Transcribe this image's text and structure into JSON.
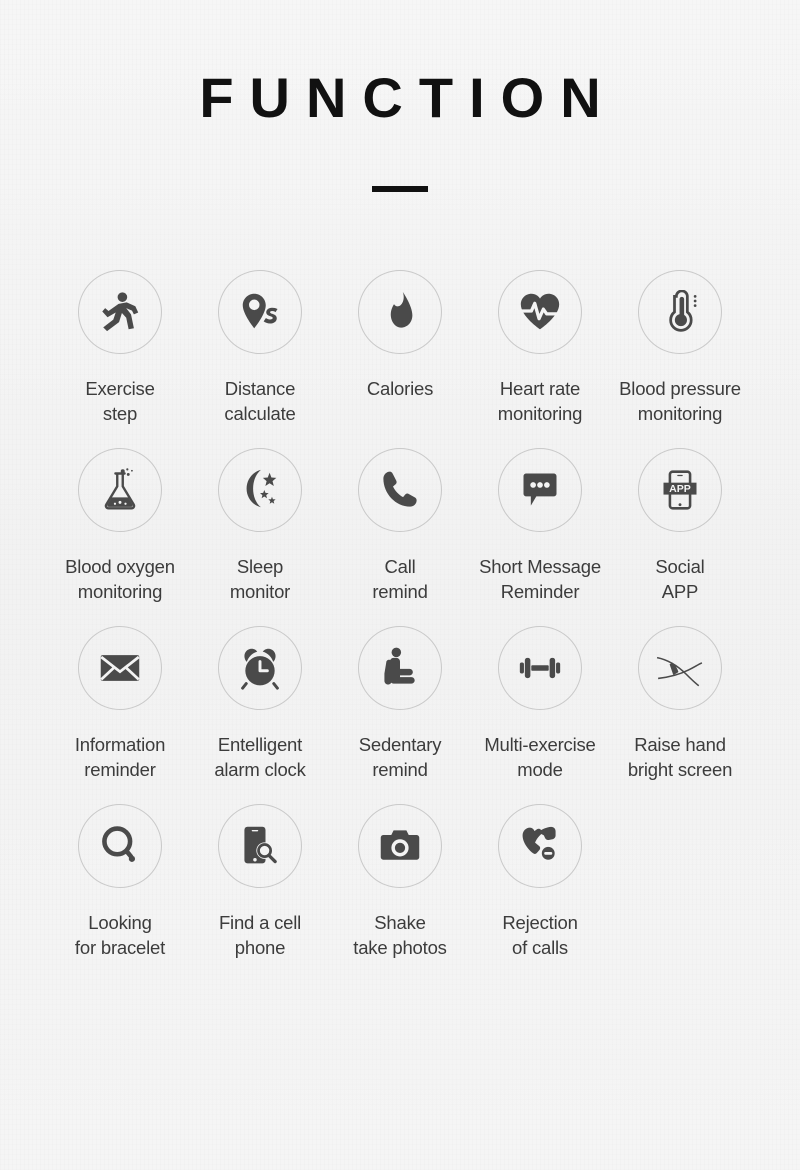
{
  "header": {
    "title": "FUNCTION"
  },
  "colors": {
    "background": "#f4f4f4",
    "title": "#111111",
    "icon": "#4a4a4a",
    "circle_stroke": "#c9c9c9",
    "label": "#3c3c3c"
  },
  "rows": [
    {
      "items": [
        {
          "icon": "running-person-icon",
          "label": "Exercise\nstep"
        },
        {
          "icon": "location-pin-route-icon",
          "label": "Distance\ncalculate"
        },
        {
          "icon": "flame-icon",
          "label": "Calories"
        },
        {
          "icon": "heart-pulse-icon",
          "label": "Heart rate\nmonitoring"
        },
        {
          "icon": "thermometer-icon",
          "label": "Blood pressure\nmonitoring"
        }
      ]
    },
    {
      "items": [
        {
          "icon": "flask-bubbles-icon",
          "label": "Blood oxygen\nmonitoring"
        },
        {
          "icon": "moon-stars-icon",
          "label": "Sleep\nmonitor"
        },
        {
          "icon": "phone-handset-icon",
          "label": "Call\nremind"
        },
        {
          "icon": "speech-bubble-dots-icon",
          "label": "Short Message\nReminder"
        },
        {
          "icon": "phone-app-icon",
          "label": "Social\nAPP",
          "icon_text": "APP"
        }
      ]
    },
    {
      "items": [
        {
          "icon": "envelope-icon",
          "label": "Information\nreminder"
        },
        {
          "icon": "alarm-clock-icon",
          "label": "Entelligent\nalarm clock"
        },
        {
          "icon": "seated-person-icon",
          "label": "Sedentary\nremind"
        },
        {
          "icon": "dumbbell-icon",
          "label": "Multi-exercise\nmode"
        },
        {
          "icon": "wrist-band-icon",
          "label": "Raise hand\nbright screen"
        }
      ]
    },
    {
      "items": [
        {
          "icon": "magnifier-ring-icon",
          "label": "Looking\nfor bracelet"
        },
        {
          "icon": "phone-search-icon",
          "label": "Find a cell\nphone"
        },
        {
          "icon": "camera-icon",
          "label": "Shake\ntake photos"
        },
        {
          "icon": "call-reject-icon",
          "label": "Rejection\nof calls"
        }
      ]
    }
  ]
}
